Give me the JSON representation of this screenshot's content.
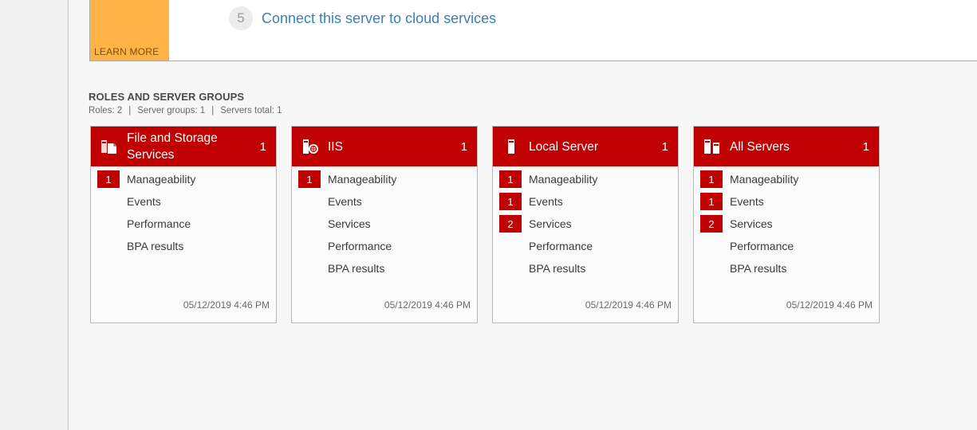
{
  "welcome": {
    "learn_more": "LEARN MORE",
    "step_number": "5",
    "step_text": "Connect this server to cloud services"
  },
  "roles_section": {
    "title": "ROLES AND SERVER GROUPS",
    "roles": "Roles: 2",
    "server_groups": "Server groups: 1",
    "servers_total": "Servers total: 1",
    "separator": "|"
  },
  "tiles": [
    {
      "icon": "file-storage-icon",
      "title": "File and Storage Services",
      "count": "1",
      "rows": [
        {
          "label": "Manageability",
          "badge": "1"
        },
        {
          "label": "Events",
          "badge": ""
        },
        {
          "label": "Performance",
          "badge": ""
        },
        {
          "label": "BPA results",
          "badge": ""
        }
      ],
      "timestamp": "05/12/2019 4:46 PM"
    },
    {
      "icon": "iis-icon",
      "title": "IIS",
      "count": "1",
      "rows": [
        {
          "label": "Manageability",
          "badge": "1"
        },
        {
          "label": "Events",
          "badge": ""
        },
        {
          "label": "Services",
          "badge": ""
        },
        {
          "label": "Performance",
          "badge": ""
        },
        {
          "label": "BPA results",
          "badge": ""
        }
      ],
      "timestamp": "05/12/2019 4:46 PM"
    },
    {
      "icon": "local-server-icon",
      "title": "Local Server",
      "count": "1",
      "rows": [
        {
          "label": "Manageability",
          "badge": "1"
        },
        {
          "label": "Events",
          "badge": "1"
        },
        {
          "label": "Services",
          "badge": "2"
        },
        {
          "label": "Performance",
          "badge": ""
        },
        {
          "label": "BPA results",
          "badge": ""
        }
      ],
      "timestamp": "05/12/2019 4:46 PM"
    },
    {
      "icon": "all-servers-icon",
      "title": "All Servers",
      "count": "1",
      "rows": [
        {
          "label": "Manageability",
          "badge": "1"
        },
        {
          "label": "Events",
          "badge": "1"
        },
        {
          "label": "Services",
          "badge": "2"
        },
        {
          "label": "Performance",
          "badge": ""
        },
        {
          "label": "BPA results",
          "badge": ""
        }
      ],
      "timestamp": "05/12/2019 4:46 PM"
    }
  ],
  "colors": {
    "tile_header": "#c00000",
    "learn_more_tile": "#ffb347",
    "link": "#3a80b8"
  }
}
